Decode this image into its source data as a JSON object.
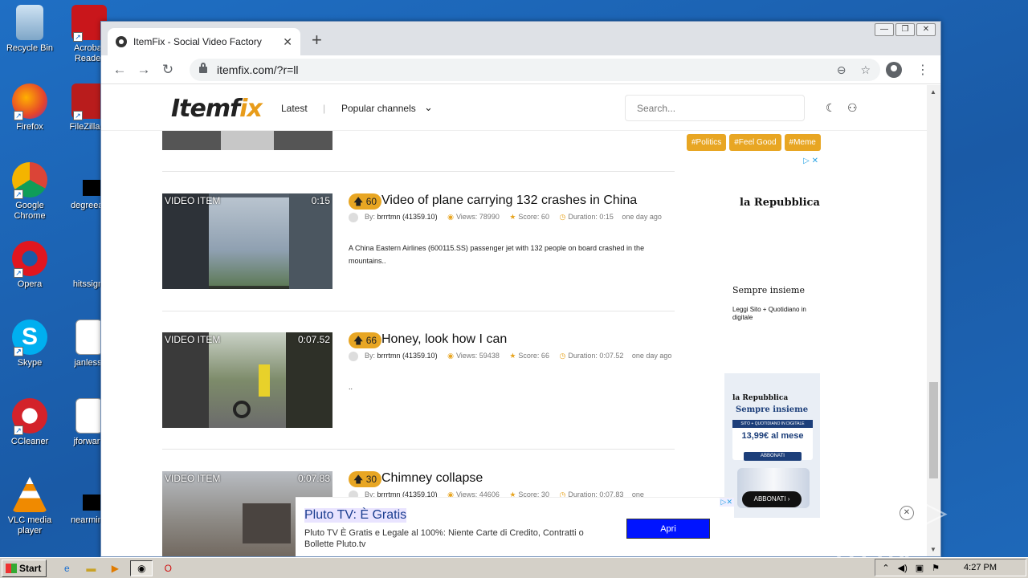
{
  "desktop": {
    "icons": [
      {
        "label": "Recycle Bin"
      },
      {
        "label": "Acrobat Reader"
      },
      {
        "label": "Firefox"
      },
      {
        "label": "FileZilla C"
      },
      {
        "label": "Google Chrome"
      },
      {
        "label": "degreeac"
      },
      {
        "label": "Opera"
      },
      {
        "label": "hitssign."
      },
      {
        "label": "Skype"
      },
      {
        "label": "janless."
      },
      {
        "label": "CCleaner"
      },
      {
        "label": "jforward"
      },
      {
        "label": "VLC media player"
      },
      {
        "label": "nearminu"
      }
    ]
  },
  "browser": {
    "tab_title": "ItemFix - Social Video Factory",
    "tab_close": "✕",
    "new_tab": "+",
    "url": "itemfix.com/?r=ll",
    "window_controls": [
      "—",
      "❐",
      "✕"
    ]
  },
  "site": {
    "logo_main": "Itemf",
    "logo_accent": "ix",
    "nav_latest": "Latest",
    "nav_sep": "|",
    "nav_popular": "Popular channels",
    "search_placeholder": "Search...",
    "tags": [
      "#Politics",
      "#Feel Good",
      "#Meme"
    ],
    "items": [
      {
        "label": "VIDEO ITEM",
        "duration": "0:15",
        "score": "60",
        "title": "Video of plane carrying 132 crashes in China",
        "by": "By:",
        "user": "brrrtmn (41359.10)",
        "views": "Views: 78990",
        "score_text": "Score: 60",
        "duration_text": "Duration: 0:15",
        "age": "one day ago",
        "description": "A China Eastern Airlines (600115.SS) passenger jet with 132 people on board crashed in the mountains.."
      },
      {
        "label": "VIDEO ITEM",
        "duration": "0:07.52",
        "score": "66",
        "title": "Honey, look how I can",
        "by": "By:",
        "user": "brrrtmn (41359.10)",
        "views": "Views: 59438",
        "score_text": "Score: 66",
        "duration_text": "Duration: 0:07.52",
        "age": "one day ago",
        "description": ".."
      },
      {
        "label": "VIDEO ITEM",
        "duration": "0:07.83",
        "score": "30",
        "title": "Chimney collapse",
        "by": "By:",
        "user": "brrrtmn (41359.10)",
        "views": "Views: 44606",
        "score_text": "Score: 30",
        "duration_text": "Duration: 0:07.83",
        "age": "one"
      }
    ]
  },
  "ad_right": {
    "brand": "la Repubblica",
    "tagline": "Sempre insieme",
    "small": "Leggi Sito + Quotidiano in digitale",
    "promo_brand": "la Repubblica",
    "promo_tagline": "Sempre insieme",
    "promo_band": "SITO + QUOTIDIANO IN DIGITALE",
    "promo_price": "13,99€ al mese",
    "promo_btn": "ABBONATI",
    "promo_cta": "ABBONATI ›"
  },
  "ad_bottom": {
    "headline": "Pluto TV: È Gratis",
    "body": "Pluto TV È Gratis e Legale al 100%: Niente Carte di Credito, Contratti o Bollette Pluto.tv",
    "cta": "Apri"
  },
  "taskbar": {
    "start": "Start",
    "clock": "4:27 PM"
  },
  "watermark": "ANY ▷ RUN"
}
